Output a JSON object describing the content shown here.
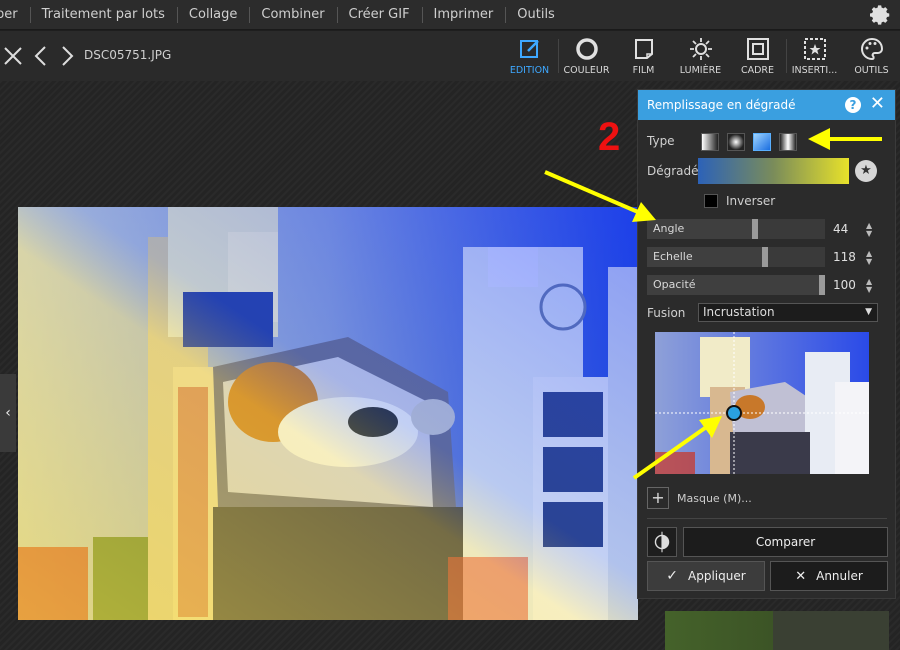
{
  "menu": {
    "items": [
      "per",
      "Traitement par lots",
      "Collage",
      "Combiner",
      "Créer GIF",
      "Imprimer",
      "Outils"
    ]
  },
  "toolbar": {
    "filename": "DSC05751.JPG",
    "tools": [
      {
        "label": "EDITION",
        "icon": "edit-icon",
        "active": true
      },
      {
        "label": "COULEUR",
        "icon": "color-icon"
      },
      {
        "label": "FILM",
        "icon": "film-icon"
      },
      {
        "label": "LUMIÈRE",
        "icon": "sun-icon"
      },
      {
        "label": "CADRE",
        "icon": "frame-icon"
      },
      {
        "label": "INSERTI...",
        "icon": "insert-icon"
      },
      {
        "label": "OUTILS",
        "icon": "palette-icon"
      }
    ]
  },
  "panel": {
    "title": "Remplissage en dégradé",
    "type_label": "Type",
    "gradient_label": "Dégradé",
    "invert_label": "Inverser",
    "sliders": [
      {
        "label": "Angle",
        "value": "44",
        "fraction": 0.61
      },
      {
        "label": "Echelle",
        "value": "118",
        "fraction": 0.67
      },
      {
        "label": "Opacité",
        "value": "100",
        "fraction": 1.0
      }
    ],
    "blend_label": "Fusion",
    "blend_value": "Incrustation",
    "mask_label": "Masque (M)...",
    "compare_label": "Comparer",
    "apply_label": "Appliquer",
    "cancel_label": "Annuler"
  },
  "annotation": {
    "step_number": "2",
    "arrow_color": "#ffff00",
    "number_color": "#ee1111"
  },
  "colors": {
    "accent": "#3a9fe0",
    "gradient_start": "#2c62b8",
    "gradient_end": "#e8e22a"
  }
}
